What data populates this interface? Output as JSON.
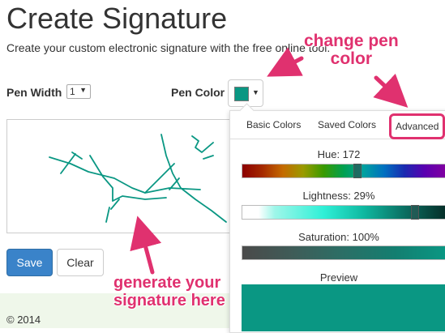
{
  "header": {
    "title": "Create Signature",
    "subtitle": "Create your custom electronic signature with the free online tool."
  },
  "controls": {
    "pen_width_label": "Pen Width",
    "pen_width_value": "1",
    "pen_color_label": "Pen Color",
    "pen_color_hex": "#0a9783"
  },
  "buttons": {
    "save": "Save",
    "clear": "Clear"
  },
  "footer": {
    "copyright": "© 2014"
  },
  "color_picker": {
    "tabs": [
      "Basic Colors",
      "Saved Colors",
      "Advanced"
    ],
    "active_tab": "Advanced",
    "hue_label": "Hue: 172",
    "hue_value": 172,
    "lightness_label": "Lightness: 29%",
    "lightness_value": 29,
    "saturation_label": "Saturation: 100%",
    "saturation_value": 100,
    "preview_label": "Preview",
    "preview_color": "#0a9783"
  },
  "annotations": {
    "pen_color_line1": "change pen",
    "pen_color_line2": "color",
    "signature_line1": "generate your",
    "signature_line2": "signature here",
    "color": "#e0316f"
  }
}
